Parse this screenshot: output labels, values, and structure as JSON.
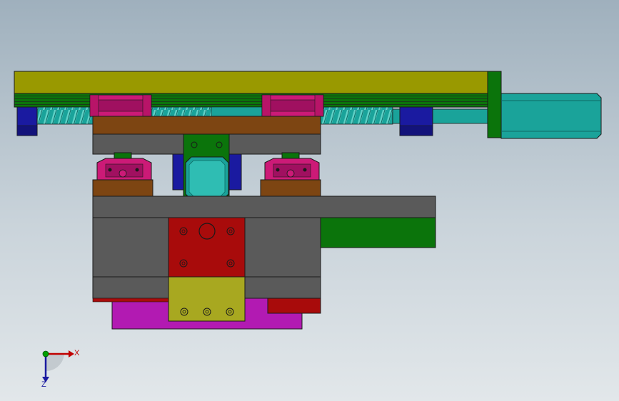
{
  "viewport": {
    "background_top": "#9fb0bd",
    "background_bottom": "#e2e7ea"
  },
  "colors": {
    "olive": "#999900",
    "dark_green": "#0b740b",
    "dark_stripes": "#2a5a2a",
    "teal": "#1aa39a",
    "teal_light": "#2fbdb3",
    "magenta": "#cc1a77",
    "magenta_dark": "#a01060",
    "navy": "#1a1aa0",
    "brown": "#7d4512",
    "gray": "#5a5a5a",
    "dark_red": "#a80b0b",
    "purple": "#b21ab2",
    "yellow_olive": "#a8a820",
    "outline": "#1a1a1a"
  },
  "triad": {
    "x_label": "X",
    "z_label": "Z",
    "x_color": "#c00000",
    "z_color": "#1a1aa0",
    "y_color": "#00a000"
  },
  "icons": {
    "triad": "coordinate-triad-icon"
  }
}
